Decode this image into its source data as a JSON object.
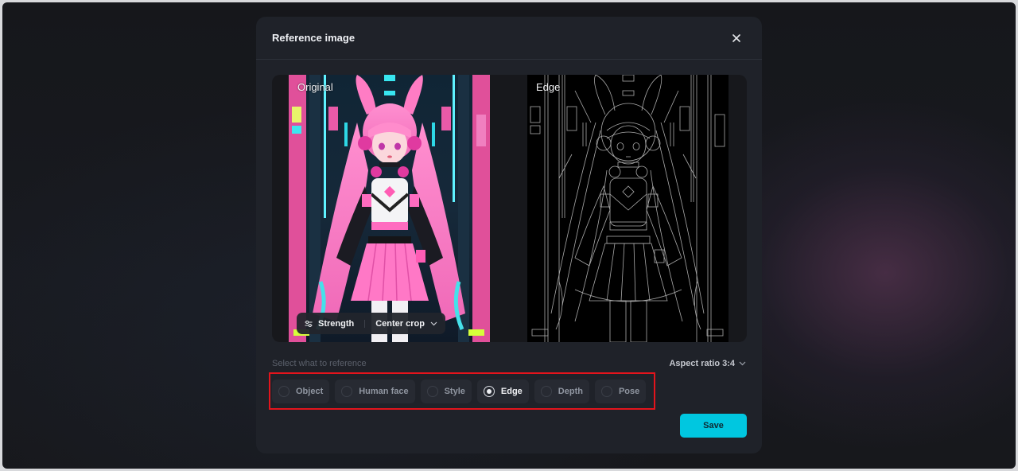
{
  "modal": {
    "title": "Reference image",
    "close_icon": "close-icon"
  },
  "preview": {
    "original_label": "Original",
    "edge_label": "Edge",
    "toolbar": {
      "strength_label": "Strength",
      "strength_icon": "sliders-icon",
      "crop_label": "Center crop",
      "crop_icon": "chevron-down-icon"
    }
  },
  "reference": {
    "section_label": "Select what to reference",
    "aspect_ratio_label": "Aspect ratio 3:4",
    "options": [
      {
        "label": "Object",
        "selected": false
      },
      {
        "label": "Human face",
        "selected": false
      },
      {
        "label": "Style",
        "selected": false
      },
      {
        "label": "Edge",
        "selected": true
      },
      {
        "label": "Depth",
        "selected": false
      },
      {
        "label": "Pose",
        "selected": false
      }
    ]
  },
  "actions": {
    "save_label": "Save"
  },
  "colors": {
    "accent": "#00c7e0",
    "highlight_frame": "#e3141c",
    "modal_bg": "#1f2229"
  }
}
